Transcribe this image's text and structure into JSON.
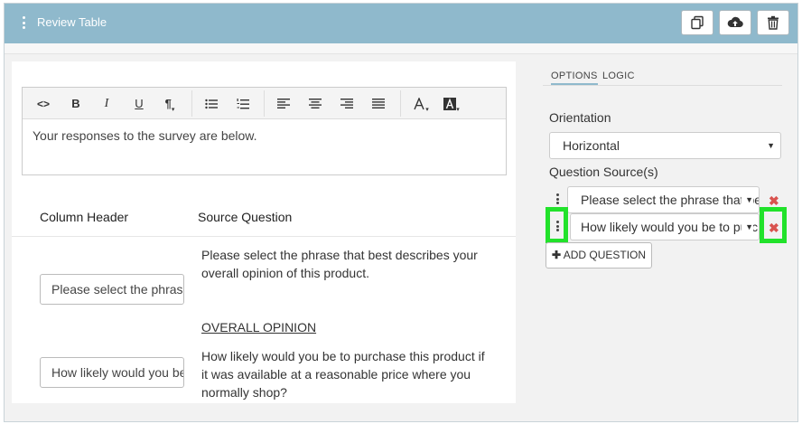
{
  "header": {
    "title": "Review Table",
    "actions": [
      {
        "name": "copy-button",
        "icon": "copy-icon"
      },
      {
        "name": "save-cloud-button",
        "icon": "cloud-upload-icon"
      },
      {
        "name": "delete-button",
        "icon": "trash-icon"
      }
    ]
  },
  "editor": {
    "toolbar": [
      "<>",
      "B",
      "I",
      "U",
      "¶"
    ],
    "body_text": "Your responses to the survey are below."
  },
  "table": {
    "columns": [
      "Column Header",
      "Source Question"
    ],
    "rows": [
      {
        "header_value": "Please select the phrase that best describes your overall opinion of this product.",
        "question": "Please select the phrase that best describes your overall opinion of this product.",
        "tag": "OVERALL OPINION"
      },
      {
        "header_value": "How likely would you be to purchase this product if it was available at a reasonable price where you normally shop?",
        "question": "How likely would you be to purchase this product if it was available at a reasonable price where you normally shop?"
      }
    ]
  },
  "panel": {
    "tabs": [
      "OPTIONS",
      "LOGIC"
    ],
    "orientation_label": "Orientation",
    "orientation_value": "Horizontal",
    "source_label": "Question Source(s)",
    "sources": [
      "Please select the phrase that best describes your overall opinion of this product.",
      "How likely would you be to purchase this product if it was available at a reasonable price where you normally shop?"
    ],
    "add_question_label": "ADD QUESTION"
  },
  "colors": {
    "header_bg": "#8fb9cc",
    "highlight": "#22e22b",
    "remove_red": "#d9534f"
  }
}
